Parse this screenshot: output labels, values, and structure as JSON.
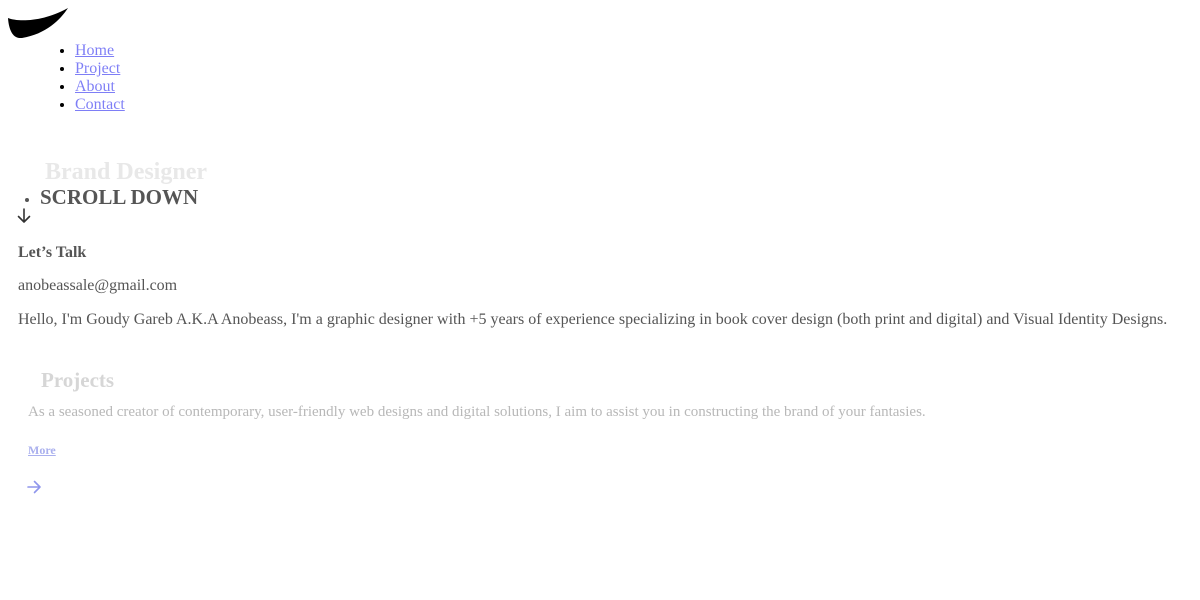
{
  "logo": {
    "icon": "brush-stroke-logo",
    "color": "#000000"
  },
  "nav": {
    "items": [
      {
        "label": "Home"
      },
      {
        "label": "Project"
      },
      {
        "label": "About"
      },
      {
        "label": "Contact"
      }
    ]
  },
  "hero": {
    "title": "Brand Designer",
    "scroll_label": "SCROLL DOWN",
    "scroll_icon": "arrow-down-icon"
  },
  "contact": {
    "title": "Let’s Talk",
    "email": "anobeassale@gmail.com"
  },
  "bio": "Hello, I'm Goudy Gareb A.K.A Anobeass, I'm a graphic designer with +5 years of experience specializing in book cover design (both print and digital) and Visual Identity Designs.",
  "projects": {
    "title": "Projects",
    "description": "As a seasoned creator of contemporary, user-friendly web designs and digital solutions, I aim to assist you in constructing the brand of your fantasies.",
    "more_label": "More",
    "more_icon": "arrow-right-icon"
  },
  "colors": {
    "link": "#0000ee",
    "text_muted": "#555555",
    "faded": "#b8b8b8"
  }
}
